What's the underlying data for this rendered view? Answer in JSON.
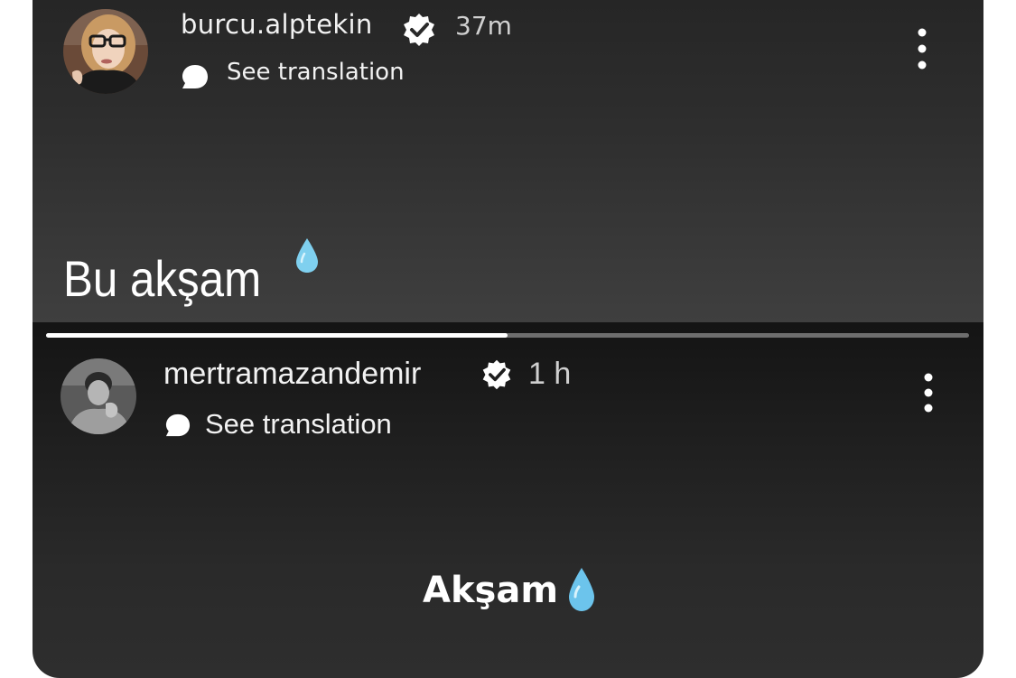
{
  "stories": [
    {
      "username": "burcu.alptekin",
      "verified": true,
      "time_ago": "37m",
      "translation_label": "See translation",
      "caption": "Bu akşam",
      "caption_emoji": "droplet-icon"
    },
    {
      "username": "mertramazandemir",
      "verified": true,
      "time_ago": "1 h",
      "translation_label": "See translation",
      "caption": "Akşam",
      "caption_emoji": "droplet-icon",
      "progress": 0.5
    }
  ],
  "colors": {
    "background": "#ffffff",
    "story_bg_dark": "#1e1e1e",
    "text": "#f2f2f2",
    "progress_fill": "#ffffff",
    "progress_track": "#6e6e6e",
    "droplet": "#7fd0ef"
  }
}
